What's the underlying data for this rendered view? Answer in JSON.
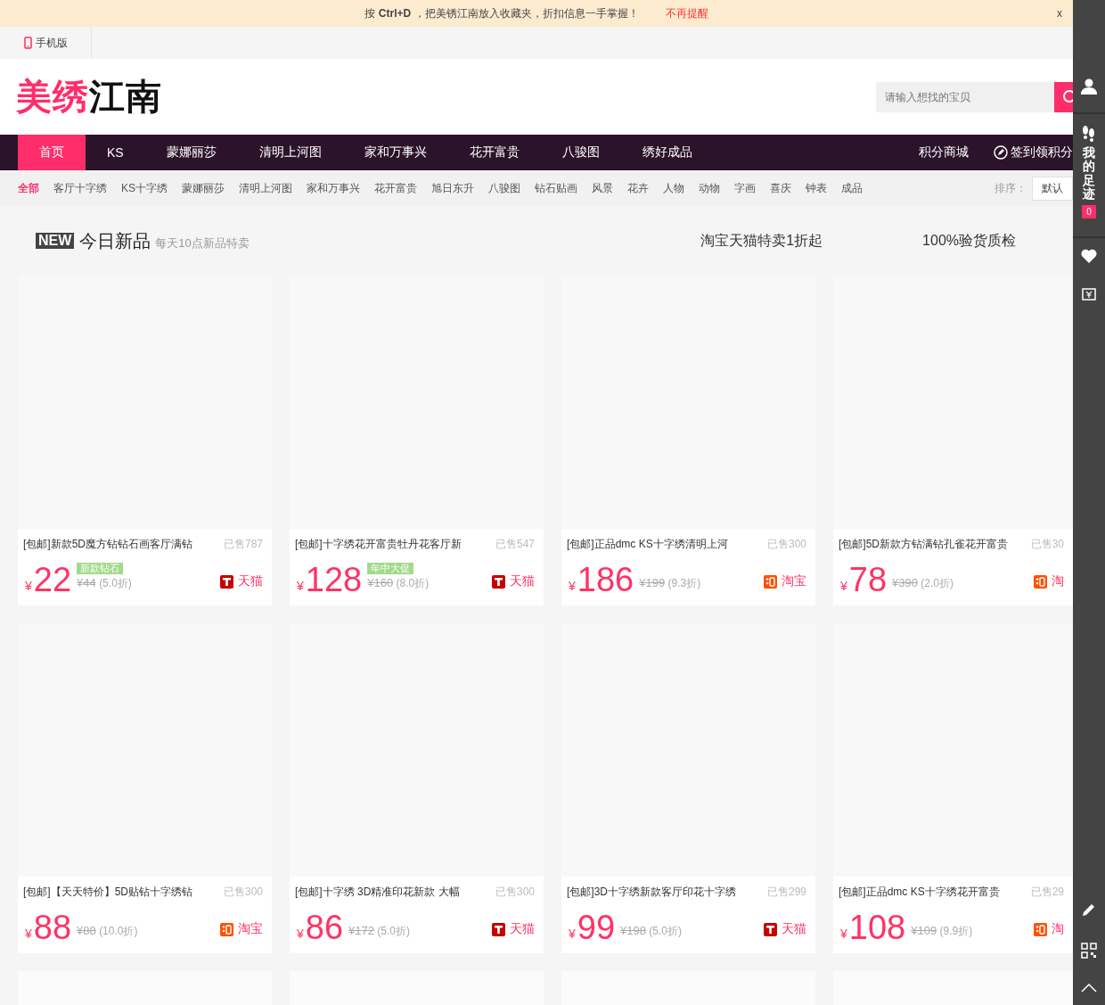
{
  "notice_bar": {
    "text": "按 **Ctrl+D** ，把美锈江南放入收藏夹，折扣信息一手掌握！",
    "dismiss_link": "不再提醒",
    "close": "x"
  },
  "utility_bar": {
    "mobile_link": "手机版"
  },
  "header": {
    "logo_accent": "美绣",
    "logo_main": "江南",
    "search": {
      "placeholder": "请输入想找的宝贝"
    }
  },
  "nav": {
    "items": [
      {
        "label": "首页",
        "selected": true
      },
      {
        "label": "KS",
        "selected": false
      },
      {
        "label": "蒙娜丽莎",
        "selected": false
      },
      {
        "label": "清明上河图",
        "selected": false
      },
      {
        "label": "家和万事兴",
        "selected": false
      },
      {
        "label": "花开富贵",
        "selected": false
      },
      {
        "label": "八骏图",
        "selected": false
      },
      {
        "label": "绣好成品",
        "selected": false
      }
    ],
    "right_links": [
      "积分商城"
    ],
    "checkin_link": "签到领积分"
  },
  "categories": {
    "items": [
      {
        "label": "全部",
        "selected": true
      },
      {
        "label": "客厅十字绣",
        "selected": false
      },
      {
        "label": "KS十字绣",
        "selected": false
      },
      {
        "label": "蒙娜丽莎",
        "selected": false
      },
      {
        "label": "清明上河图",
        "selected": false
      },
      {
        "label": "家和万事兴",
        "selected": false
      },
      {
        "label": "花开富贵",
        "selected": false
      },
      {
        "label": "旭日东升",
        "selected": false
      },
      {
        "label": "八骏图",
        "selected": false
      },
      {
        "label": "钻石贴画",
        "selected": false
      },
      {
        "label": "风景",
        "selected": false
      },
      {
        "label": "花卉",
        "selected": false
      },
      {
        "label": "人物",
        "selected": false
      },
      {
        "label": "动物",
        "selected": false
      },
      {
        "label": "字画",
        "selected": false
      },
      {
        "label": "喜庆",
        "selected": false
      },
      {
        "label": "钟表",
        "selected": false
      },
      {
        "label": "成品",
        "selected": false
      }
    ],
    "sort_label": "排序：",
    "sort_value": "默认"
  },
  "section": {
    "badge": "NEW",
    "title": "今日新品",
    "subtitle": "每天10点新品特卖",
    "promises": [
      "淘宝天猫特卖1折起",
      "100%验货质检"
    ]
  },
  "cards": [
    {
      "kind": "product",
      "title": "[包邮]新款5D魔方钻钻石画客厅满钻",
      "sold": "已售787",
      "currency": "¥",
      "price": "22",
      "tag": "新款钻石",
      "original_price": "¥44",
      "discount": "(5.0折)",
      "platform": {
        "kind": "tmall",
        "label": "天猫"
      }
    },
    {
      "kind": "product",
      "title": "[包邮]十字绣花开富贵牡丹花客厅新",
      "sold": "已售547",
      "currency": "¥",
      "price": "128",
      "tag": "年中大促",
      "original_price": "¥160",
      "discount": "(8.0折)",
      "platform": {
        "kind": "tmall",
        "label": "天猫"
      }
    },
    {
      "kind": "product",
      "title": "[包邮]正品dmc KS十字绣清明上河",
      "sold": "已售300",
      "currency": "¥",
      "price": "186",
      "original_price": "¥199",
      "discount": "(9.3折)",
      "platform": {
        "kind": "taobao",
        "label": "淘宝"
      }
    },
    {
      "kind": "product",
      "title": "[包邮]5D新款方钻满钻孔雀花开富贵",
      "sold": "已售30",
      "currency": "¥",
      "price": "78",
      "original_price": "¥390",
      "discount": "(2.0折)",
      "platform": {
        "kind": "taobao",
        "label": "淘"
      }
    },
    {
      "kind": "product",
      "title": "[包邮]【天天特价】5D贴钻十字绣钻",
      "sold": "已售300",
      "currency": "¥",
      "price": "88",
      "original_price": "¥88",
      "discount": "(10.0折)",
      "platform": {
        "kind": "taobao",
        "label": "淘宝"
      }
    },
    {
      "kind": "product",
      "title": "[包邮]十字绣 3D精准印花新款 大幅",
      "sold": "已售300",
      "currency": "¥",
      "price": "86",
      "original_price": "¥172",
      "discount": "(5.0折)",
      "platform": {
        "kind": "tmall",
        "label": "天猫"
      }
    },
    {
      "kind": "product",
      "title": "[包邮]3D十字绣新款客厅印花十字绣",
      "sold": "已售299",
      "currency": "¥",
      "price": "99",
      "original_price": "¥198",
      "discount": "(5.0折)",
      "platform": {
        "kind": "tmall",
        "label": "天猫"
      }
    },
    {
      "kind": "product",
      "title": "[包邮]正品dmc KS十字绣花开富贵",
      "sold": "已售29",
      "currency": "¥",
      "price": "108",
      "original_price": "¥109",
      "discount": "(9.9折)",
      "platform": {
        "kind": "taobao",
        "label": "淘"
      }
    },
    {
      "kind": "placeholder"
    },
    {
      "kind": "placeholder"
    },
    {
      "kind": "placeholder"
    },
    {
      "kind": "placeholder"
    }
  ],
  "side_toolbar": {
    "footprints_label": "我的足迹",
    "footprints_count": "0"
  }
}
